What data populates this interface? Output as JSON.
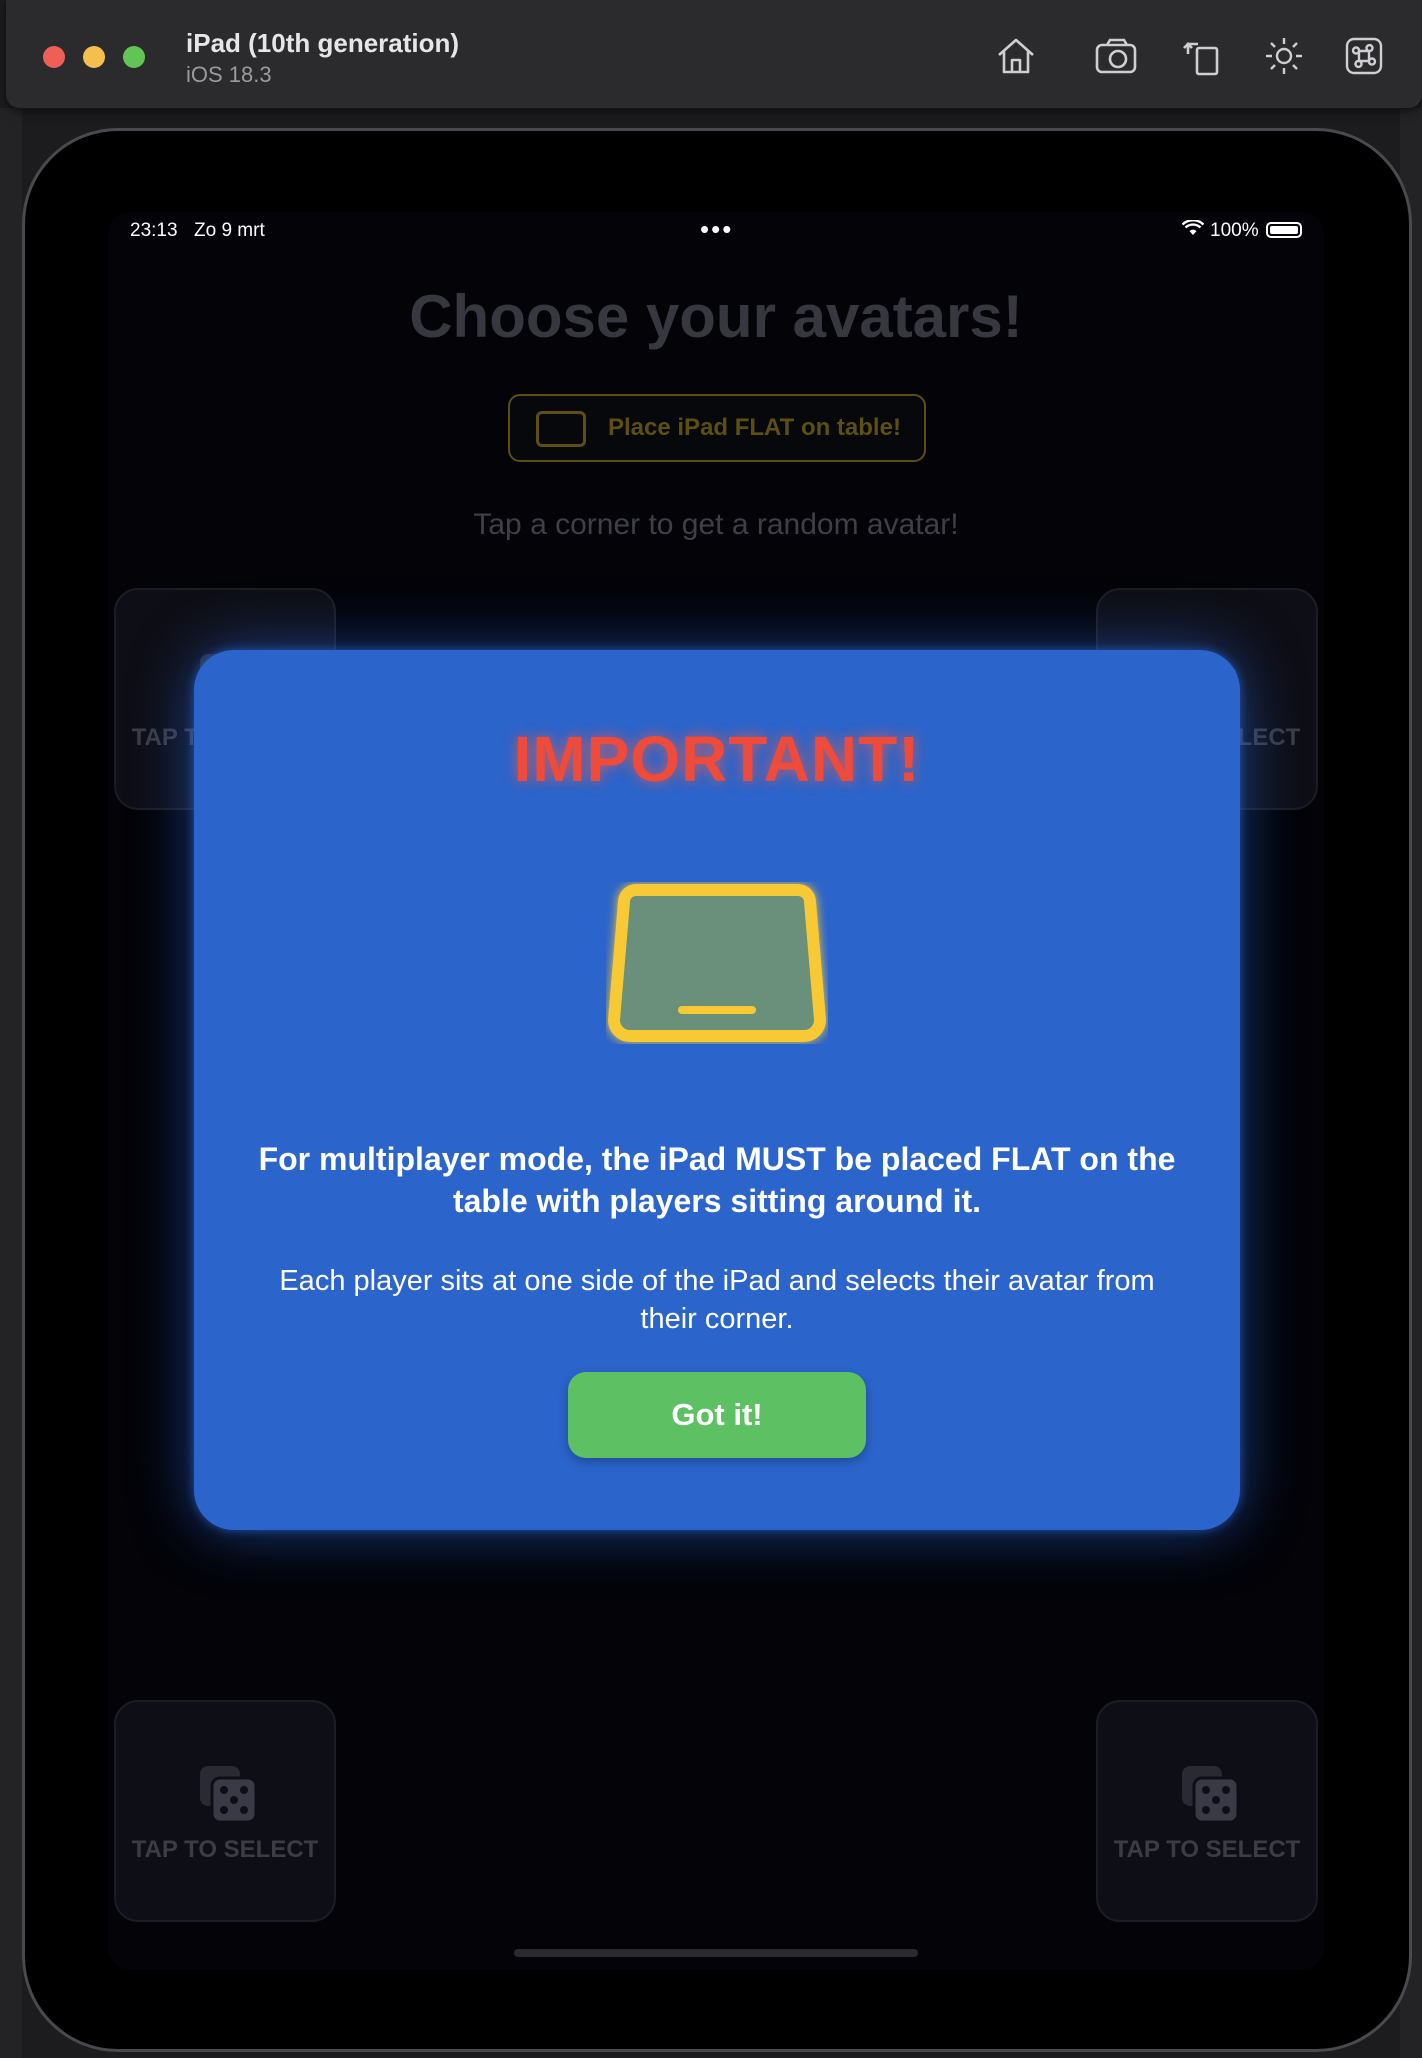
{
  "simulator": {
    "device_name": "iPad (10th generation)",
    "os_version": "iOS 18.3",
    "toolbar_icons": [
      "home-icon",
      "screenshot-icon",
      "rotate-icon",
      "brightness-icon",
      "command-icon"
    ]
  },
  "statusbar": {
    "time": "23:13",
    "date": "Zo 9 mrt",
    "dots": "•••",
    "battery": "100%"
  },
  "app": {
    "title": "Choose your avatars!",
    "flat_banner": "Place iPad FLAT on table!",
    "hint": "Tap a corner to get a random avatar!",
    "corners": [
      {
        "label": "TAP TO SELECT"
      },
      {
        "label": "TAP TO SELECT"
      },
      {
        "label": "TAP TO SELECT"
      },
      {
        "label": "TAP TO SELECT"
      }
    ]
  },
  "modal": {
    "title": "IMPORTANT!",
    "bold_text": "For multiplayer mode, the iPad MUST be placed FLAT on the table with players sitting around it.",
    "body_text": "Each player sits at one side of the iPad and selects their avatar from their corner.",
    "button_label": "Got it!"
  },
  "colors": {
    "modal_bg": "#2b64cb",
    "title_red": "#ee4b3a",
    "button_green": "#5dc163",
    "ipad_yellow": "#f6c935"
  }
}
